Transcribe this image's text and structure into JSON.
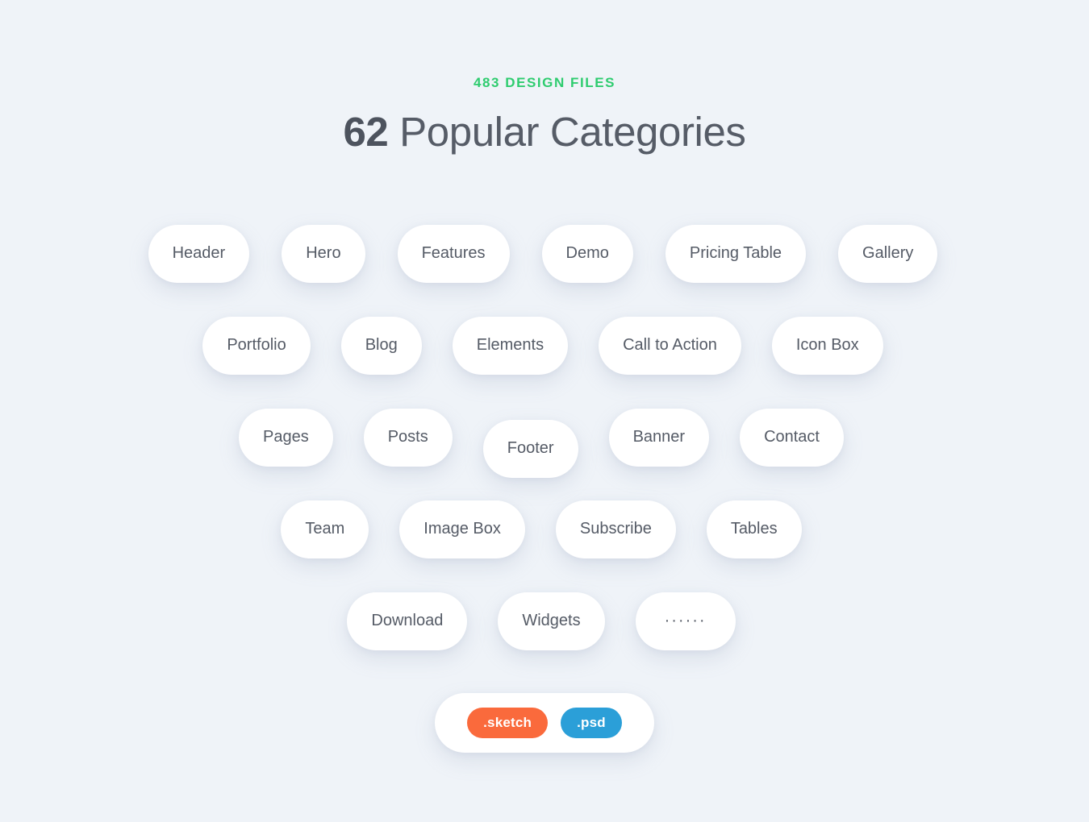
{
  "header": {
    "eyebrow": "483 DESIGN FILES",
    "title_count": "62",
    "title_rest": " Popular Categories",
    "eyebrow_color": "#2ecc6f",
    "title_color": "#565c67"
  },
  "background_color": "#eff3f8",
  "pill_style": {
    "background": "#ffffff",
    "text_color": "#555b66"
  },
  "categories": {
    "rows": [
      {
        "pills": [
          {
            "label": "Header"
          },
          {
            "label": "Hero"
          },
          {
            "label": "Features"
          },
          {
            "label": "Demo"
          },
          {
            "label": "Pricing Table"
          },
          {
            "label": "Gallery"
          }
        ]
      },
      {
        "pills": [
          {
            "label": "Portfolio"
          },
          {
            "label": "Blog"
          },
          {
            "label": "Elements"
          },
          {
            "label": "Call to Action"
          },
          {
            "label": "Icon Box"
          }
        ]
      },
      {
        "pills": [
          {
            "label": "Pages"
          },
          {
            "label": "Posts"
          },
          {
            "label": "Footer"
          },
          {
            "label": "Banner"
          },
          {
            "label": "Contact"
          }
        ]
      },
      {
        "pills": [
          {
            "label": "Team"
          },
          {
            "label": "Image Box"
          },
          {
            "label": "Subscribe"
          },
          {
            "label": "Tables"
          }
        ]
      },
      {
        "pills": [
          {
            "label": "Download"
          },
          {
            "label": "Widgets"
          },
          {
            "label": "······"
          }
        ]
      }
    ]
  },
  "formats": {
    "badges": [
      {
        "label": ".sketch",
        "color": "#fa6a3c"
      },
      {
        "label": ".psd",
        "color": "#2b9fd8"
      }
    ]
  }
}
